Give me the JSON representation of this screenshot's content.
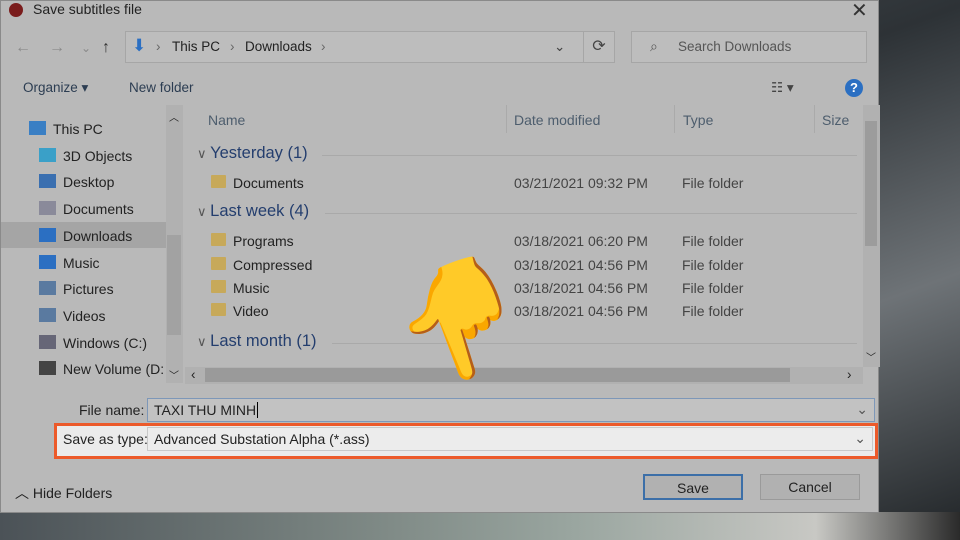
{
  "window": {
    "title": "Save subtitles file",
    "close": "✕"
  },
  "nav": {
    "back": "←",
    "forward": "→",
    "recent": "⌄",
    "up": "↑",
    "path": [
      "This PC",
      "Downloads"
    ],
    "refresh": "⟳",
    "search_placeholder": "Search Downloads"
  },
  "toolbar": {
    "organize": "Organize ▾",
    "new_folder": "New folder",
    "view": "☷ ▾",
    "help": "?"
  },
  "sidebar": {
    "items": [
      {
        "label": "This PC",
        "icon": "computer-icon"
      },
      {
        "label": "3D Objects",
        "icon": "cube-icon"
      },
      {
        "label": "Desktop",
        "icon": "desktop-icon"
      },
      {
        "label": "Documents",
        "icon": "documents-icon"
      },
      {
        "label": "Downloads",
        "icon": "download-icon",
        "selected": true
      },
      {
        "label": "Music",
        "icon": "music-icon"
      },
      {
        "label": "Pictures",
        "icon": "pictures-icon"
      },
      {
        "label": "Videos",
        "icon": "videos-icon"
      },
      {
        "label": "Windows (C:)",
        "icon": "drive-icon"
      },
      {
        "label": "New Volume (D:",
        "icon": "drive-icon"
      }
    ]
  },
  "columns": [
    "Name",
    "Date modified",
    "Type",
    "Size"
  ],
  "groups": [
    {
      "label": "Yesterday (1)",
      "files": [
        {
          "name": "Documents",
          "date": "03/21/2021 09:32 PM",
          "type": "File folder"
        }
      ]
    },
    {
      "label": "Last week (4)",
      "files": [
        {
          "name": "Programs",
          "date": "03/18/2021 06:20 PM",
          "type": "File folder"
        },
        {
          "name": "Compressed",
          "date": "03/18/2021 04:56 PM",
          "type": "File folder"
        },
        {
          "name": "Music",
          "date": "03/18/2021 04:56 PM",
          "type": "File folder"
        },
        {
          "name": "Video",
          "date": "03/18/2021 04:56 PM",
          "type": "File folder"
        }
      ]
    },
    {
      "label": "Last month (1)",
      "files": []
    }
  ],
  "form": {
    "file_name_label": "File name:",
    "file_name": "TAXI THU MINH",
    "type_label": "Save as type:",
    "type_value": "Advanced Substation Alpha (*.ass)"
  },
  "footer": {
    "hide_folders": "Hide Folders",
    "save": "Save",
    "cancel": "Cancel"
  },
  "overlay": {
    "pointer": "👇",
    "highlight_color": "#ec5a2a"
  }
}
